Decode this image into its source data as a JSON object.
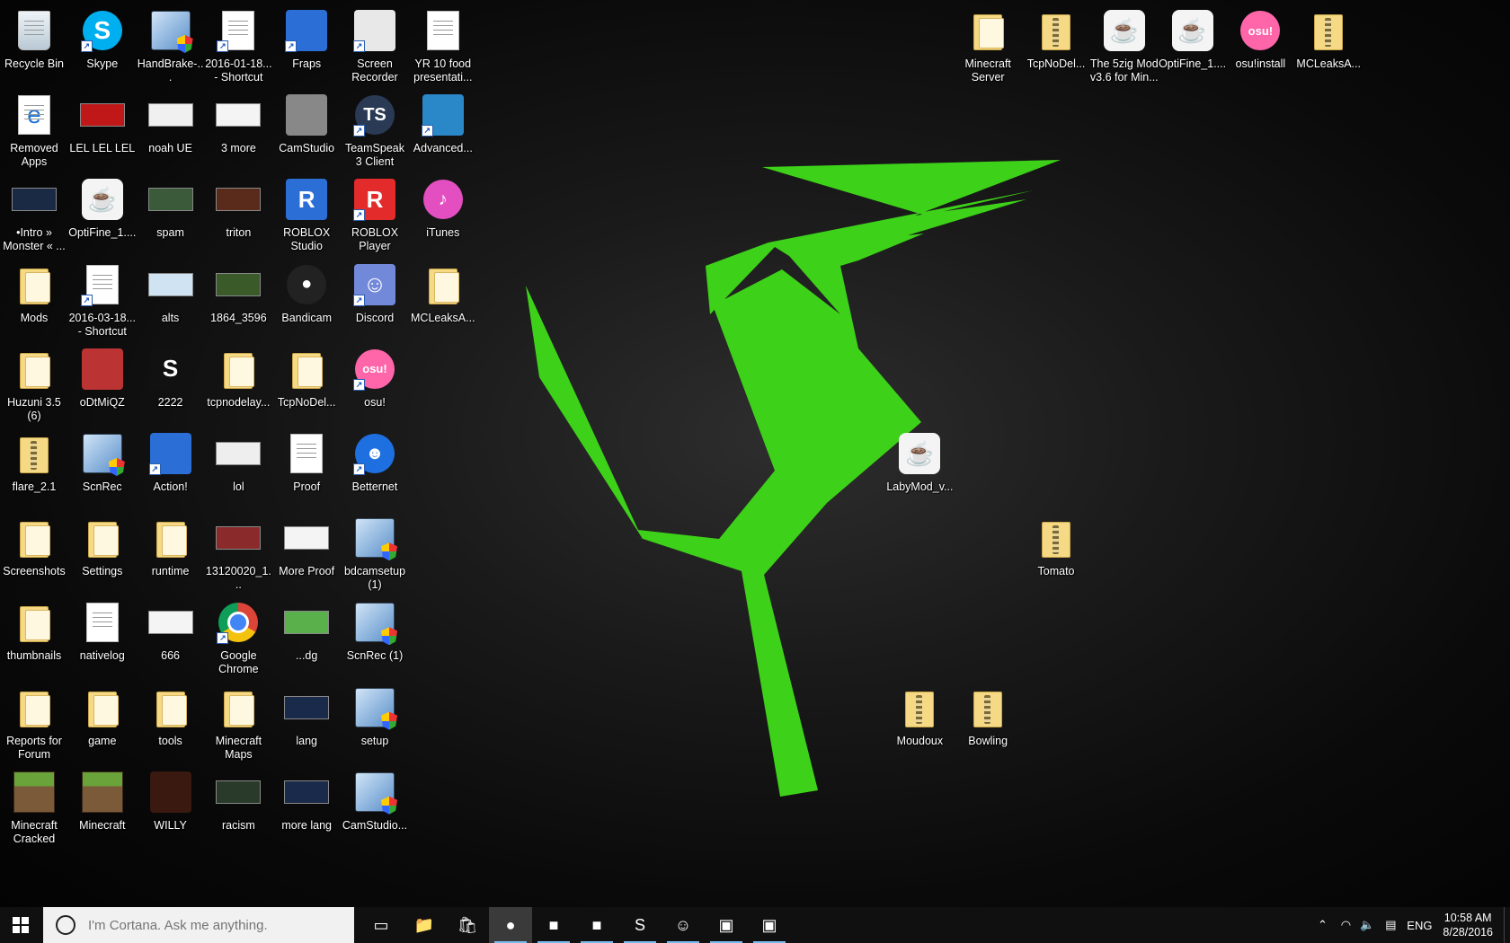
{
  "desktop": {
    "icons": [
      {
        "label": "Recycle Bin",
        "icon": "recycle-bin-icon",
        "kind": "recycle",
        "col": 0,
        "row": 0
      },
      {
        "label": "Skype",
        "icon": "skype-icon",
        "kind": "skype",
        "col": 1,
        "row": 0,
        "shortcut": true
      },
      {
        "label": "HandBrake-...",
        "icon": "handbrake-icon",
        "kind": "installer",
        "col": 2,
        "row": 0
      },
      {
        "label": "2016-01-18... - Shortcut",
        "icon": "image-shortcut-icon",
        "kind": "doc",
        "col": 3,
        "row": 0,
        "shortcut": true
      },
      {
        "label": "Fraps",
        "icon": "fraps-icon",
        "kind": "sq",
        "color": "#2b6fd6",
        "col": 4,
        "row": 0,
        "shortcut": true
      },
      {
        "label": "Screen Recorder",
        "icon": "screen-recorder-icon",
        "kind": "sq",
        "color": "#e8e8e8",
        "col": 5,
        "row": 0,
        "shortcut": true
      },
      {
        "label": "YR 10 food presentati...",
        "icon": "docx-icon",
        "kind": "doc",
        "col": 6,
        "row": 0
      },
      {
        "label": "Removed Apps",
        "icon": "edge-file-icon",
        "kind": "edge",
        "col": 0,
        "row": 1
      },
      {
        "label": "LEL LEL LEL",
        "icon": "image-thumb-icon",
        "kind": "thumb",
        "color": "#c01818",
        "col": 1,
        "row": 1
      },
      {
        "label": "noah UE",
        "icon": "image-thumb-icon",
        "kind": "thumb",
        "color": "#f0f0f0",
        "col": 2,
        "row": 1
      },
      {
        "label": "3 more",
        "icon": "image-thumb-icon",
        "kind": "thumb",
        "color": "#f4f4f4",
        "col": 3,
        "row": 1
      },
      {
        "label": "CamStudio",
        "icon": "camstudio-icon",
        "kind": "sq",
        "color": "#888",
        "col": 4,
        "row": 1
      },
      {
        "label": "TeamSpeak 3 Client",
        "icon": "teamspeak-icon",
        "kind": "round",
        "color": "#2a3a55",
        "text": "TS",
        "col": 5,
        "row": 1,
        "shortcut": true
      },
      {
        "label": "Advanced...",
        "icon": "advanced-tool-icon",
        "kind": "sq",
        "color": "#2a88c9",
        "col": 6,
        "row": 1,
        "shortcut": true
      },
      {
        "label": "•Intro » Monster « ...",
        "icon": "video-thumb-icon",
        "kind": "thumb",
        "color": "#1b2a44",
        "col": 0,
        "row": 2
      },
      {
        "label": "OptiFine_1....",
        "icon": "java-icon",
        "kind": "java",
        "col": 1,
        "row": 2
      },
      {
        "label": "spam",
        "icon": "image-thumb-icon",
        "kind": "thumb",
        "color": "#3a5a3a",
        "col": 2,
        "row": 2
      },
      {
        "label": "triton",
        "icon": "image-thumb-icon",
        "kind": "thumb",
        "color": "#5a2a1a",
        "col": 3,
        "row": 2
      },
      {
        "label": "ROBLOX Studio",
        "icon": "roblox-studio-icon",
        "kind": "sq",
        "color": "#2b6fd6",
        "text": "R",
        "col": 4,
        "row": 2
      },
      {
        "label": "ROBLOX Player",
        "icon": "roblox-player-icon",
        "kind": "sq",
        "color": "#e32b2b",
        "text": "R",
        "col": 5,
        "row": 2,
        "shortcut": true
      },
      {
        "label": "iTunes",
        "icon": "itunes-icon",
        "kind": "round",
        "color": "#e34ec0",
        "text": "♪",
        "col": 6,
        "row": 2
      },
      {
        "label": "Mods",
        "icon": "folder-icon",
        "kind": "folder",
        "col": 0,
        "row": 3
      },
      {
        "label": "2016-03-18... - Shortcut",
        "icon": "image-shortcut-icon",
        "kind": "doc",
        "col": 1,
        "row": 3,
        "shortcut": true
      },
      {
        "label": "alts",
        "icon": "image-thumb-icon",
        "kind": "thumb",
        "color": "#cfe3f3",
        "col": 2,
        "row": 3
      },
      {
        "label": "1864_3596",
        "icon": "video-thumb-icon",
        "kind": "thumb",
        "color": "#3a5a2a",
        "col": 3,
        "row": 3
      },
      {
        "label": "Bandicam",
        "icon": "bandicam-icon",
        "kind": "round",
        "color": "#222",
        "text": "●",
        "col": 4,
        "row": 3
      },
      {
        "label": "Discord",
        "icon": "discord-icon",
        "kind": "sq",
        "color": "#7289da",
        "text": "☺",
        "col": 5,
        "row": 3,
        "shortcut": true
      },
      {
        "label": "MCLeaksA...",
        "icon": "folder-icon",
        "kind": "folder",
        "col": 6,
        "row": 3
      },
      {
        "label": "Huzuni 3.5 (6)",
        "icon": "folder-icon",
        "kind": "folder",
        "col": 0,
        "row": 4
      },
      {
        "label": "oDtMiQZ",
        "icon": "skin-icon",
        "kind": "sq",
        "color": "#b33",
        "col": 1,
        "row": 4
      },
      {
        "label": "2222",
        "icon": "logo-thumb-icon",
        "kind": "sq",
        "color": "#111",
        "text": "S",
        "col": 2,
        "row": 4
      },
      {
        "label": "tcpnodelay...",
        "icon": "folder-icon",
        "kind": "folder",
        "col": 3,
        "row": 4
      },
      {
        "label": "TcpNoDel...",
        "icon": "folder-icon",
        "kind": "folder",
        "col": 4,
        "row": 4
      },
      {
        "label": "osu!",
        "icon": "osu-icon",
        "kind": "round",
        "color": "#ff66aa",
        "text": "osu!",
        "col": 5,
        "row": 4,
        "shortcut": true
      },
      {
        "label": "flare_2.1",
        "icon": "zip-folder-icon",
        "kind": "zip",
        "col": 0,
        "row": 5
      },
      {
        "label": "ScnRec",
        "icon": "installer-icon",
        "kind": "installer",
        "col": 1,
        "row": 5
      },
      {
        "label": "Action!",
        "icon": "action-icon",
        "kind": "sq",
        "color": "#2b6fd6",
        "col": 2,
        "row": 5,
        "shortcut": true
      },
      {
        "label": "lol",
        "icon": "image-thumb-icon",
        "kind": "thumb",
        "color": "#eee",
        "col": 3,
        "row": 5
      },
      {
        "label": "Proof",
        "icon": "document-icon",
        "kind": "doc",
        "col": 4,
        "row": 5
      },
      {
        "label": "Betternet",
        "icon": "betternet-icon",
        "kind": "round",
        "color": "#1e6fe0",
        "text": "☻",
        "col": 5,
        "row": 5,
        "shortcut": true
      },
      {
        "label": "Screenshots",
        "icon": "folder-icon",
        "kind": "folder",
        "col": 0,
        "row": 6
      },
      {
        "label": "Settings",
        "icon": "folder-icon",
        "kind": "folder",
        "col": 1,
        "row": 6
      },
      {
        "label": "runtime",
        "icon": "folder-icon",
        "kind": "folder",
        "col": 2,
        "row": 6
      },
      {
        "label": "13120020_1...",
        "icon": "image-thumb-icon",
        "kind": "thumb",
        "color": "#8a2a2a",
        "col": 3,
        "row": 6
      },
      {
        "label": "More Proof",
        "icon": "image-thumb-icon",
        "kind": "thumb",
        "color": "#f4f4f4",
        "col": 4,
        "row": 6
      },
      {
        "label": "bdcamsetup (1)",
        "icon": "installer-icon",
        "kind": "installer",
        "col": 5,
        "row": 6
      },
      {
        "label": "thumbnails",
        "icon": "folder-icon",
        "kind": "folder",
        "col": 0,
        "row": 7
      },
      {
        "label": "nativelog",
        "icon": "text-file-icon",
        "kind": "doc",
        "col": 1,
        "row": 7
      },
      {
        "label": "666",
        "icon": "image-thumb-icon",
        "kind": "thumb",
        "color": "#f4f4f4",
        "col": 2,
        "row": 7
      },
      {
        "label": "Google Chrome",
        "icon": "chrome-icon",
        "kind": "chrome",
        "col": 3,
        "row": 7,
        "shortcut": true
      },
      {
        "label": "...dg",
        "icon": "image-thumb-icon",
        "kind": "thumb",
        "color": "#5ab04a",
        "col": 4,
        "row": 7
      },
      {
        "label": "ScnRec (1)",
        "icon": "installer-icon",
        "kind": "installer",
        "col": 5,
        "row": 7
      },
      {
        "label": "Reports for Forum",
        "icon": "folder-icon",
        "kind": "folder",
        "col": 0,
        "row": 8
      },
      {
        "label": "game",
        "icon": "folder-icon",
        "kind": "folder",
        "col": 1,
        "row": 8
      },
      {
        "label": "tools",
        "icon": "folder-icon",
        "kind": "folder",
        "col": 2,
        "row": 8
      },
      {
        "label": "Minecraft Maps",
        "icon": "folder-icon",
        "kind": "folder",
        "col": 3,
        "row": 8
      },
      {
        "label": "lang",
        "icon": "image-thumb-icon",
        "kind": "thumb",
        "color": "#1a2a4a",
        "col": 4,
        "row": 8
      },
      {
        "label": "setup",
        "icon": "installer-icon",
        "kind": "installer",
        "col": 5,
        "row": 8
      },
      {
        "label": "Minecraft Cracked",
        "icon": "minecraft-icon",
        "kind": "mc",
        "col": 0,
        "row": 9
      },
      {
        "label": "Minecraft",
        "icon": "minecraft-icon",
        "kind": "mc",
        "col": 1,
        "row": 9
      },
      {
        "label": "WILLY",
        "icon": "skin-icon",
        "kind": "sq",
        "color": "#3a1a10",
        "col": 2,
        "row": 9
      },
      {
        "label": "racism",
        "icon": "image-thumb-icon",
        "kind": "thumb",
        "color": "#2a3a2a",
        "col": 3,
        "row": 9
      },
      {
        "label": "more lang",
        "icon": "image-thumb-icon",
        "kind": "thumb",
        "color": "#1a2a4a",
        "col": 4,
        "row": 9
      },
      {
        "label": "CamStudio...",
        "icon": "installer-icon",
        "kind": "installer",
        "col": 5,
        "row": 9
      },
      {
        "label": "Minecraft Server",
        "icon": "folder-icon",
        "kind": "folder",
        "col": 14,
        "row": 0
      },
      {
        "label": "TcpNoDel...",
        "icon": "zip-folder-icon",
        "kind": "zip",
        "col": 15,
        "row": 0
      },
      {
        "label": "The 5zig Mod v3.6 for Min...",
        "icon": "java-icon",
        "kind": "java",
        "col": 16,
        "row": 0
      },
      {
        "label": "OptiFine_1....",
        "icon": "java-icon",
        "kind": "java",
        "col": 17,
        "row": 0
      },
      {
        "label": "osu!install",
        "icon": "osu-icon",
        "kind": "round",
        "color": "#ff66aa",
        "text": "osu!",
        "col": 18,
        "row": 0
      },
      {
        "label": "MCLeaksA...",
        "icon": "zip-folder-icon",
        "kind": "zip",
        "col": 19,
        "row": 0
      },
      {
        "label": "LabyMod_v...",
        "icon": "java-icon",
        "kind": "java",
        "col": 13,
        "row": 5
      },
      {
        "label": "Tomato",
        "icon": "zip-folder-icon",
        "kind": "zip",
        "col": 15,
        "row": 6
      },
      {
        "label": "Moudoux",
        "icon": "zip-folder-icon",
        "kind": "zip",
        "col": 13,
        "row": 8
      },
      {
        "label": "Bowling",
        "icon": "zip-folder-icon",
        "kind": "zip",
        "col": 14,
        "row": 8
      }
    ]
  },
  "taskbar": {
    "search_placeholder": "I'm Cortana. Ask me anything.",
    "apps": [
      {
        "icon": "task-view-icon",
        "glyph": "▭",
        "state": "none"
      },
      {
        "icon": "file-explorer-icon",
        "glyph": "📁",
        "state": "none"
      },
      {
        "icon": "store-icon",
        "glyph": "🛍",
        "state": "none"
      },
      {
        "icon": "chrome-icon",
        "glyph": "●",
        "state": "active"
      },
      {
        "icon": "minecraft-icon",
        "glyph": "■",
        "state": "run"
      },
      {
        "icon": "minecraft-icon",
        "glyph": "■",
        "state": "run"
      },
      {
        "icon": "skype-icon",
        "glyph": "S",
        "state": "run"
      },
      {
        "icon": "discord-icon",
        "glyph": "☺",
        "state": "run"
      },
      {
        "icon": "chest-icon",
        "glyph": "▣",
        "state": "run"
      },
      {
        "icon": "chest-icon",
        "glyph": "▣",
        "state": "run"
      }
    ],
    "language": "ENG",
    "time": "10:58 AM",
    "date": "8/28/2016"
  },
  "colors": {
    "logo_green": "#3dd119",
    "taskbar": "#101010",
    "accent": "#76b9ed"
  }
}
